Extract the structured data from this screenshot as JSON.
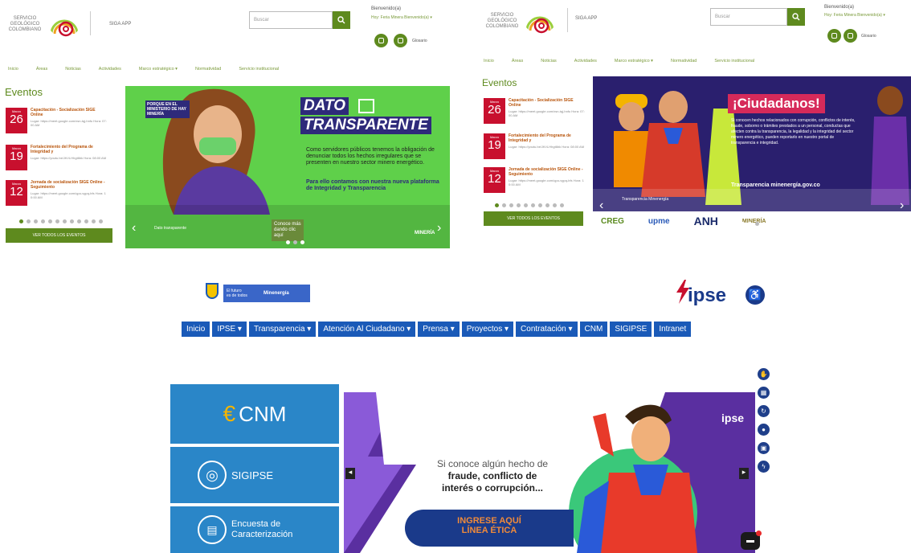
{
  "sgc_left": {
    "logo_text": "SERVICIO GEOLÓGICO COLOMBIANO",
    "sub_name": "SIGA APP",
    "search_placeholder": "Buscar",
    "welcome_title": "Bienvenido(a)",
    "welcome_sub": "Hoy: Feria Minera Bienvenido(a) ▾",
    "help_label": "Glosario",
    "nav": [
      "Inicio",
      "Áreas",
      "Noticias",
      "Actividades",
      "Marco estratégico ▾",
      "Normatividad",
      "Servicio institucional"
    ],
    "events_title": "Eventos",
    "events": [
      {
        "month": "Marzo",
        "day": "26",
        "title": "Capacitación - Socialización SIGE Online",
        "body": "Lugar: https://meet.google.com/xsn-tqj-hnfu Hora: 07:00 AM"
      },
      {
        "month": "Marzo",
        "day": "19",
        "title": "Fortalecimiento del Programa de Integridad y",
        "body": "Lugar: https://youtu.be/JtV4-Hhgt6bk Hora: 08:00 AM"
      },
      {
        "month": "Marzo",
        "day": "12",
        "title": "Jornada de socialización SIGE Online - Seguimiento",
        "body": "Lugar: https://meet.google.com/qpo-vgpq-bfs Hora: 10:00 AM"
      }
    ],
    "events_button": "VER TODOS LOS EVENTOS",
    "banner": {
      "tag": "PORQUE EN EL MINISTERIO DE HAY MINERÍA",
      "title1": "DATO",
      "title2": "TRANSPARENTE",
      "text": "Como servidores públicos tenemos la obligación de denunciar todos los hechos irregulares que se presenten en nuestro sector minero energético.",
      "text_bold": "Para ello contamos con nuestra nueva plataforma de Integridad y Transparencia",
      "caption": "Dato transparente",
      "cta": "Conoce más dando clic aquí",
      "logo": "MINERÍA"
    }
  },
  "sgc_right": {
    "logo_text": "SERVICIO GEOLÓGICO COLOMBIANO",
    "sub_name": "SIGA APP",
    "search_placeholder": "Buscar",
    "welcome_title": "Bienvenido(a)",
    "welcome_sub": "Hoy: Feria Minera Bienvenido(a) ▾",
    "help_label": "Glosario",
    "nav": [
      "Inicio",
      "Áreas",
      "Noticias",
      "Actividades",
      "Marco estratégico ▾",
      "Normatividad",
      "Servicio institucional"
    ],
    "events_title": "Eventos",
    "events": [
      {
        "month": "Marzo",
        "day": "26",
        "title": "Capacitación - Socialización SIGE Online",
        "body": "Lugar: https://meet.google.com/xsn-tqj-hnfu Hora: 07:00 AM"
      },
      {
        "month": "Marzo",
        "day": "19",
        "title": "Fortalecimiento del Programa de Integridad y",
        "body": "Lugar: https://youtu.be/JtV4-Hhgt6bk Hora: 08:00 AM"
      },
      {
        "month": "Marzo",
        "day": "12",
        "title": "Jornada de socialización SIGE Online - Seguimiento",
        "body": "Lugar: https://meet.google.com/qpo-vgpq-bfs Hora: 10:00 AM"
      }
    ],
    "events_button": "VER TODOS LOS EVENTOS",
    "banner": {
      "title": "¡Ciudadanos!",
      "text": "Si conocen hechos relacionados con corrupción, conflictos de interés, fraude, soborno o trámites prestados a un personal, conductas que afecten contra la transparencia, la legalidad y la integridad del sector minero energético, pueden reportarlo en nuestro portal de transparencia e integridad.",
      "text_bold": "Transparencia minenergía.gov.co",
      "caption": "Transparencia Minenergía",
      "logos": [
        "CREG",
        "upme",
        "ANH",
        "MINERÍA"
      ]
    }
  },
  "ipse": {
    "gov_badge_line1": "El futuro",
    "gov_badge_line2": "es de todos",
    "gov_badge_ministry": "Minenergía",
    "logo": "ipse",
    "menu": [
      "Inicio",
      "IPSE ▾",
      "Transparencia ▾",
      "Atención Al Ciudadano ▾",
      "Prensa ▾",
      "Proyectos ▾",
      "Contratación ▾",
      "CNM",
      "SIGIPSE",
      "Intranet"
    ],
    "tiles": [
      "CNM",
      "SIGIPSE",
      "Encuesta de Caracterización"
    ],
    "banner_line1": "Si conoce algún hecho de",
    "banner_line2": "fraude, conflicto de",
    "banner_line3": "interés o corrupción...",
    "cta_line1": "INGRESE AQUÍ",
    "cta_line2": "LÍNEA ÉTICA",
    "banner_logo": "ipse"
  }
}
